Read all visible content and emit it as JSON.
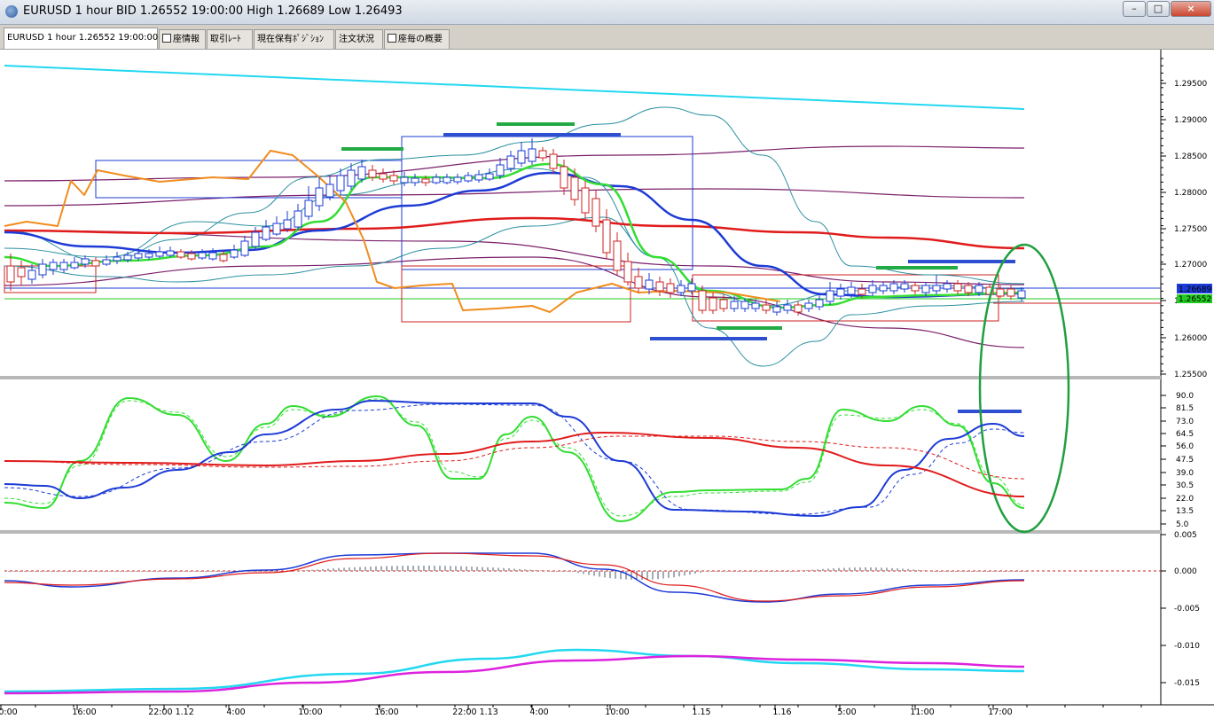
{
  "window": {
    "title": "EURUSD 1 hour BID 1.26552 19:00:00 High 1.26689 Low 1.26493",
    "buttons": {
      "minimize": "–",
      "maximize": "□",
      "close": "×"
    }
  },
  "tabs": [
    {
      "label": "EURUSD 1 hour 1.26552 19:00:00",
      "checkbox": false,
      "active": true
    },
    {
      "label": "座情報",
      "checkbox": true
    },
    {
      "label": "取引ﾚｰﾄ",
      "checkbox": false
    },
    {
      "label": "現在保有ﾎﾟｼﾞｼｮﾝ",
      "checkbox": false
    },
    {
      "label": "注文状況",
      "checkbox": false
    },
    {
      "label": "座毎の概要",
      "checkbox": true
    }
  ],
  "price_axis": {
    "labels": [
      "1.29500",
      "1.29000",
      "1.28500",
      "1.28000",
      "1.27500",
      "1.27000",
      "1.26500",
      "1.26000",
      "1.25500"
    ],
    "current_high_label": "1.26689",
    "current_bid_label": "1.26552",
    "high_label_color": "#1d3bd6",
    "bid_label_color": "#22cc22"
  },
  "osc_axis": {
    "labels": [
      "90.0",
      "81.5",
      "73.0",
      "64.5",
      "56.0",
      "47.5",
      "39.0",
      "30.5",
      "22.0",
      "13.5",
      "5.0"
    ]
  },
  "macd_axis": {
    "labels": [
      "0.005",
      "0.000",
      "-0.005",
      "-0.010",
      "-0.015"
    ]
  },
  "time_axis": {
    "labels": [
      "0:00",
      "16:00",
      "22:00 1.12",
      "4:00",
      "10:00",
      "16:00",
      "22:00 1.13",
      "4:00",
      "10:00",
      "1.15",
      "1.16",
      "5:00",
      "11:00",
      "17:00"
    ]
  },
  "colors": {
    "candle_up": "#1d3bd6",
    "candle_down": "#cc2222",
    "bollinger": "#2b8fa0",
    "ma_fast": "#33dd33",
    "ma_mid": "#1d3bd6",
    "ma_slow": "#e11b1b",
    "orange_line": "#f08c1e",
    "trendline_cyan": "#22d8f0",
    "highlight_ellipse": "#1f9f3f",
    "channel_purple": "#7a1f6a"
  }
}
